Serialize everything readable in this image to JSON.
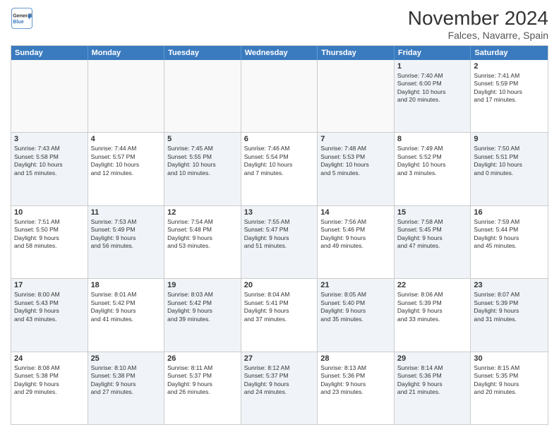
{
  "header": {
    "logo_line1": "General",
    "logo_line2": "Blue",
    "month": "November 2024",
    "location": "Falces, Navarre, Spain"
  },
  "weekdays": [
    "Sunday",
    "Monday",
    "Tuesday",
    "Wednesday",
    "Thursday",
    "Friday",
    "Saturday"
  ],
  "weeks": [
    [
      {
        "day": "",
        "info": "",
        "empty": true
      },
      {
        "day": "",
        "info": "",
        "empty": true
      },
      {
        "day": "",
        "info": "",
        "empty": true
      },
      {
        "day": "",
        "info": "",
        "empty": true
      },
      {
        "day": "",
        "info": "",
        "empty": true
      },
      {
        "day": "1",
        "info": "Sunrise: 7:40 AM\nSunset: 6:00 PM\nDaylight: 10 hours\nand 20 minutes.",
        "shaded": true
      },
      {
        "day": "2",
        "info": "Sunrise: 7:41 AM\nSunset: 5:59 PM\nDaylight: 10 hours\nand 17 minutes.",
        "shaded": false
      }
    ],
    [
      {
        "day": "3",
        "info": "Sunrise: 7:43 AM\nSunset: 5:58 PM\nDaylight: 10 hours\nand 15 minutes.",
        "shaded": true
      },
      {
        "day": "4",
        "info": "Sunrise: 7:44 AM\nSunset: 5:57 PM\nDaylight: 10 hours\nand 12 minutes.",
        "shaded": false
      },
      {
        "day": "5",
        "info": "Sunrise: 7:45 AM\nSunset: 5:55 PM\nDaylight: 10 hours\nand 10 minutes.",
        "shaded": true
      },
      {
        "day": "6",
        "info": "Sunrise: 7:46 AM\nSunset: 5:54 PM\nDaylight: 10 hours\nand 7 minutes.",
        "shaded": false
      },
      {
        "day": "7",
        "info": "Sunrise: 7:48 AM\nSunset: 5:53 PM\nDaylight: 10 hours\nand 5 minutes.",
        "shaded": true
      },
      {
        "day": "8",
        "info": "Sunrise: 7:49 AM\nSunset: 5:52 PM\nDaylight: 10 hours\nand 3 minutes.",
        "shaded": false
      },
      {
        "day": "9",
        "info": "Sunrise: 7:50 AM\nSunset: 5:51 PM\nDaylight: 10 hours\nand 0 minutes.",
        "shaded": true
      }
    ],
    [
      {
        "day": "10",
        "info": "Sunrise: 7:51 AM\nSunset: 5:50 PM\nDaylight: 9 hours\nand 58 minutes.",
        "shaded": false
      },
      {
        "day": "11",
        "info": "Sunrise: 7:53 AM\nSunset: 5:49 PM\nDaylight: 9 hours\nand 56 minutes.",
        "shaded": true
      },
      {
        "day": "12",
        "info": "Sunrise: 7:54 AM\nSunset: 5:48 PM\nDaylight: 9 hours\nand 53 minutes.",
        "shaded": false
      },
      {
        "day": "13",
        "info": "Sunrise: 7:55 AM\nSunset: 5:47 PM\nDaylight: 9 hours\nand 51 minutes.",
        "shaded": true
      },
      {
        "day": "14",
        "info": "Sunrise: 7:56 AM\nSunset: 5:46 PM\nDaylight: 9 hours\nand 49 minutes.",
        "shaded": false
      },
      {
        "day": "15",
        "info": "Sunrise: 7:58 AM\nSunset: 5:45 PM\nDaylight: 9 hours\nand 47 minutes.",
        "shaded": true
      },
      {
        "day": "16",
        "info": "Sunrise: 7:59 AM\nSunset: 5:44 PM\nDaylight: 9 hours\nand 45 minutes.",
        "shaded": false
      }
    ],
    [
      {
        "day": "17",
        "info": "Sunrise: 8:00 AM\nSunset: 5:43 PM\nDaylight: 9 hours\nand 43 minutes.",
        "shaded": true
      },
      {
        "day": "18",
        "info": "Sunrise: 8:01 AM\nSunset: 5:42 PM\nDaylight: 9 hours\nand 41 minutes.",
        "shaded": false
      },
      {
        "day": "19",
        "info": "Sunrise: 8:03 AM\nSunset: 5:42 PM\nDaylight: 9 hours\nand 39 minutes.",
        "shaded": true
      },
      {
        "day": "20",
        "info": "Sunrise: 8:04 AM\nSunset: 5:41 PM\nDaylight: 9 hours\nand 37 minutes.",
        "shaded": false
      },
      {
        "day": "21",
        "info": "Sunrise: 8:05 AM\nSunset: 5:40 PM\nDaylight: 9 hours\nand 35 minutes.",
        "shaded": true
      },
      {
        "day": "22",
        "info": "Sunrise: 8:06 AM\nSunset: 5:39 PM\nDaylight: 9 hours\nand 33 minutes.",
        "shaded": false
      },
      {
        "day": "23",
        "info": "Sunrise: 8:07 AM\nSunset: 5:39 PM\nDaylight: 9 hours\nand 31 minutes.",
        "shaded": true
      }
    ],
    [
      {
        "day": "24",
        "info": "Sunrise: 8:08 AM\nSunset: 5:38 PM\nDaylight: 9 hours\nand 29 minutes.",
        "shaded": false
      },
      {
        "day": "25",
        "info": "Sunrise: 8:10 AM\nSunset: 5:38 PM\nDaylight: 9 hours\nand 27 minutes.",
        "shaded": true
      },
      {
        "day": "26",
        "info": "Sunrise: 8:11 AM\nSunset: 5:37 PM\nDaylight: 9 hours\nand 26 minutes.",
        "shaded": false
      },
      {
        "day": "27",
        "info": "Sunrise: 8:12 AM\nSunset: 5:37 PM\nDaylight: 9 hours\nand 24 minutes.",
        "shaded": true
      },
      {
        "day": "28",
        "info": "Sunrise: 8:13 AM\nSunset: 5:36 PM\nDaylight: 9 hours\nand 23 minutes.",
        "shaded": false
      },
      {
        "day": "29",
        "info": "Sunrise: 8:14 AM\nSunset: 5:36 PM\nDaylight: 9 hours\nand 21 minutes.",
        "shaded": true
      },
      {
        "day": "30",
        "info": "Sunrise: 8:15 AM\nSunset: 5:35 PM\nDaylight: 9 hours\nand 20 minutes.",
        "shaded": false
      }
    ]
  ]
}
